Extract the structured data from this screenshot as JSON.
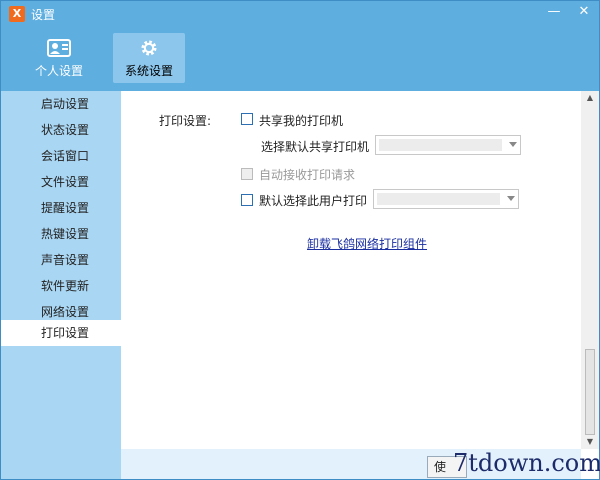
{
  "window": {
    "title": "设置",
    "app_icon": "app-logo-icon"
  },
  "top_tabs": [
    {
      "label": "个人设置",
      "icon": "id-card-icon",
      "active": false
    },
    {
      "label": "系统设置",
      "icon": "gear-icon",
      "active": true
    }
  ],
  "sidebar": {
    "items": [
      {
        "label": "启动设置"
      },
      {
        "label": "状态设置"
      },
      {
        "label": "会话窗口"
      },
      {
        "label": "文件设置"
      },
      {
        "label": "提醒设置"
      },
      {
        "label": "热键设置"
      },
      {
        "label": "声音设置"
      },
      {
        "label": "软件更新"
      },
      {
        "label": "网络设置"
      },
      {
        "label": "打印设置",
        "active": true
      }
    ]
  },
  "print_settings": {
    "section_label": "打印设置:",
    "share_printer": {
      "label": "共享我的打印机",
      "checked": false
    },
    "default_shared_printer": {
      "label": "选择默认共享打印机",
      "value": ""
    },
    "auto_accept": {
      "label": "自动接收打印请求",
      "checked": false,
      "disabled": true
    },
    "default_user_printer": {
      "label": "默认选择此用户打印",
      "checked": false,
      "value": ""
    },
    "uninstall_link": "卸载飞鸽网络打印组件"
  },
  "footer": {
    "button_label": "使"
  },
  "watermark": "7tdown.com",
  "colors": {
    "titlebar": "#5faee0",
    "sidebar": "#a9d6f2",
    "active_tab": "#8cc6ec",
    "link": "#1a2ea0"
  }
}
